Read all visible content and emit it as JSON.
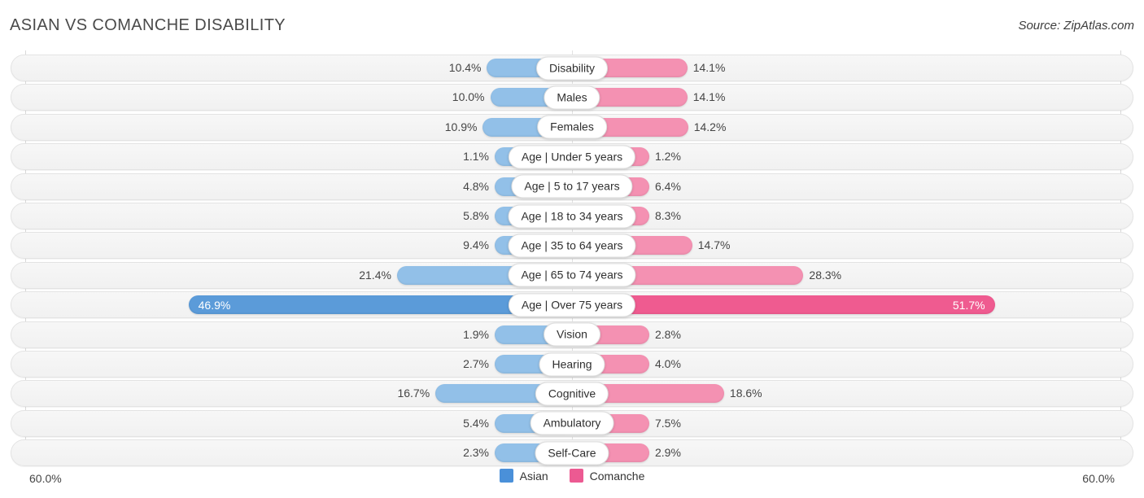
{
  "header": {
    "title": "ASIAN VS COMANCHE DISABILITY",
    "source": "Source: ZipAtlas.com"
  },
  "legend": {
    "items": [
      {
        "label": "Asian",
        "color": "#4a90d9"
      },
      {
        "label": "Comanche",
        "color": "#ec5a92"
      }
    ]
  },
  "axis": {
    "left_label": "60.0%",
    "right_label": "60.0%",
    "max": 60.0
  },
  "chart_data": {
    "type": "bar",
    "title": "ASIAN VS COMANCHE DISABILITY",
    "orientation": "horizontal-diverging",
    "xlabel": "",
    "ylabel": "",
    "xlim": [
      60.0,
      60.0
    ],
    "grid": true,
    "legend_position": "bottom-center",
    "categories": [
      "Disability",
      "Males",
      "Females",
      "Age | Under 5 years",
      "Age | 5 to 17 years",
      "Age | 18 to 34 years",
      "Age | 35 to 64 years",
      "Age | 65 to 74 years",
      "Age | Over 75 years",
      "Vision",
      "Hearing",
      "Cognitive",
      "Ambulatory",
      "Self-Care"
    ],
    "series": [
      {
        "name": "Asian",
        "color": "#92c0e8",
        "values": [
          10.4,
          10.0,
          10.9,
          1.1,
          4.8,
          5.8,
          9.4,
          21.4,
          46.9,
          1.9,
          2.7,
          16.7,
          5.4,
          2.3
        ],
        "labels": [
          "10.4%",
          "10.0%",
          "10.9%",
          "1.1%",
          "4.8%",
          "5.8%",
          "9.4%",
          "21.4%",
          "46.9%",
          "1.9%",
          "2.7%",
          "16.7%",
          "5.4%",
          "2.3%"
        ]
      },
      {
        "name": "Comanche",
        "color": "#f491b2",
        "values": [
          14.1,
          14.1,
          14.2,
          1.2,
          6.4,
          8.3,
          14.7,
          28.3,
          51.7,
          2.8,
          4.0,
          18.6,
          7.5,
          2.9
        ],
        "labels": [
          "14.1%",
          "14.1%",
          "14.2%",
          "1.2%",
          "6.4%",
          "8.3%",
          "14.7%",
          "28.3%",
          "51.7%",
          "2.8%",
          "4.0%",
          "18.6%",
          "7.5%",
          "2.9%"
        ]
      }
    ]
  }
}
